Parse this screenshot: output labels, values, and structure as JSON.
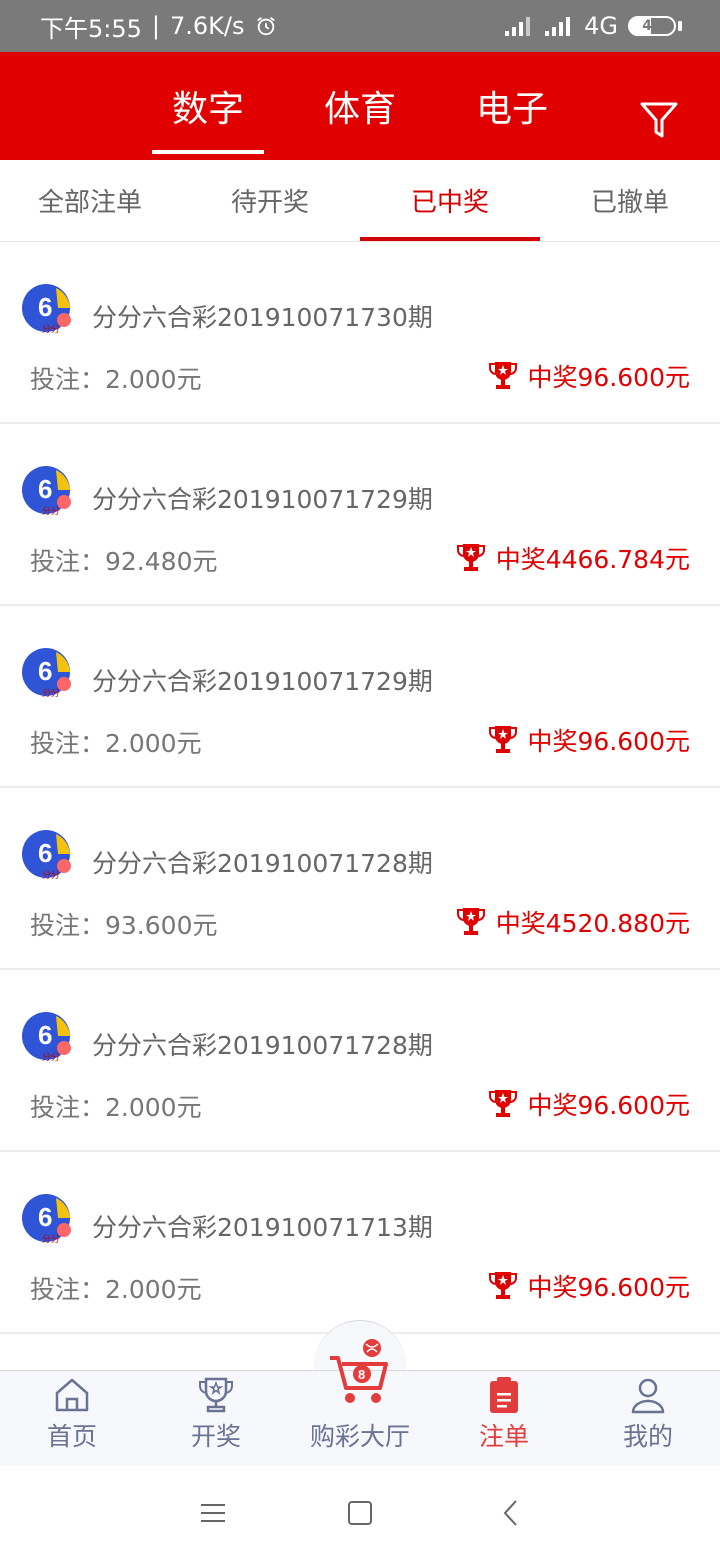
{
  "status_bar": {
    "time": "下午5:55",
    "separator": "|",
    "speed": "7.6K/s",
    "network": "4G",
    "battery": "48",
    "battery_level": 0.48
  },
  "header": {
    "tabs": [
      {
        "label": "数字",
        "active": true
      },
      {
        "label": "体育",
        "active": false
      },
      {
        "label": "电子",
        "active": false
      }
    ]
  },
  "subtabs": [
    {
      "label": "全部注单",
      "active": false
    },
    {
      "label": "待开奖",
      "active": false
    },
    {
      "label": "已中奖",
      "active": true
    },
    {
      "label": "已撤单",
      "active": false
    }
  ],
  "orders": [
    {
      "title": "分分六合彩201910071730期",
      "bet": "投注：2.000元",
      "win": "中奖96.600元"
    },
    {
      "title": "分分六合彩201910071729期",
      "bet": "投注：92.480元",
      "win": "中奖4466.784元"
    },
    {
      "title": "分分六合彩201910071729期",
      "bet": "投注：2.000元",
      "win": "中奖96.600元"
    },
    {
      "title": "分分六合彩201910071728期",
      "bet": "投注：93.600元",
      "win": "中奖4520.880元"
    },
    {
      "title": "分分六合彩201910071728期",
      "bet": "投注：2.000元",
      "win": "中奖96.600元"
    },
    {
      "title": "分分六合彩201910071713期",
      "bet": "投注：2.000元",
      "win": "中奖96.600元"
    }
  ],
  "lottery_icon": {
    "number": "6",
    "text": "分分"
  },
  "bottom_nav": [
    {
      "label": "首页",
      "icon": "home-icon",
      "active": false
    },
    {
      "label": "开奖",
      "icon": "trophy-outline-icon",
      "active": false
    },
    {
      "label": "购彩大厅",
      "icon": "cart-icon",
      "active": false
    },
    {
      "label": "注单",
      "icon": "clipboard-icon",
      "active": true
    },
    {
      "label": "我的",
      "icon": "user-icon",
      "active": false
    }
  ],
  "colors": {
    "brand_red": "#e00000",
    "tab_active": "#d40000",
    "nav_active": "#e23c3c",
    "nav_inactive": "#6b7293",
    "status_bar": "#7a7a7a"
  }
}
